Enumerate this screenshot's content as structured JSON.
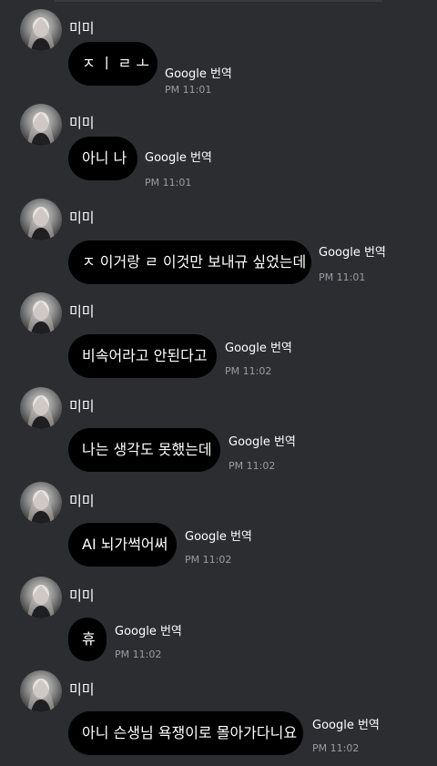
{
  "sender_name": "미미",
  "translate_label": "Google 번역",
  "messages": [
    {
      "text": "ㅈ ㅣ ㄹ ㅗ",
      "time": "PM 11:01"
    },
    {
      "text": "아니 나",
      "time": "PM 11:01"
    },
    {
      "text": "ㅈ 이거랑 ㄹ 이것만 보내규 싶었는데",
      "time": "PM 11:01"
    },
    {
      "text": "비속어라고 안된다고",
      "time": "PM 11:02"
    },
    {
      "text": "나는 생각도 못했는데",
      "time": "PM 11:02"
    },
    {
      "text": "AI 뇌가썩어써",
      "time": "PM 11:02"
    },
    {
      "text": "휴",
      "time": "PM 11:02"
    },
    {
      "text": "아니 슨생님 욕쟁이로 몰아가다니요",
      "time": "PM 11:02"
    }
  ]
}
